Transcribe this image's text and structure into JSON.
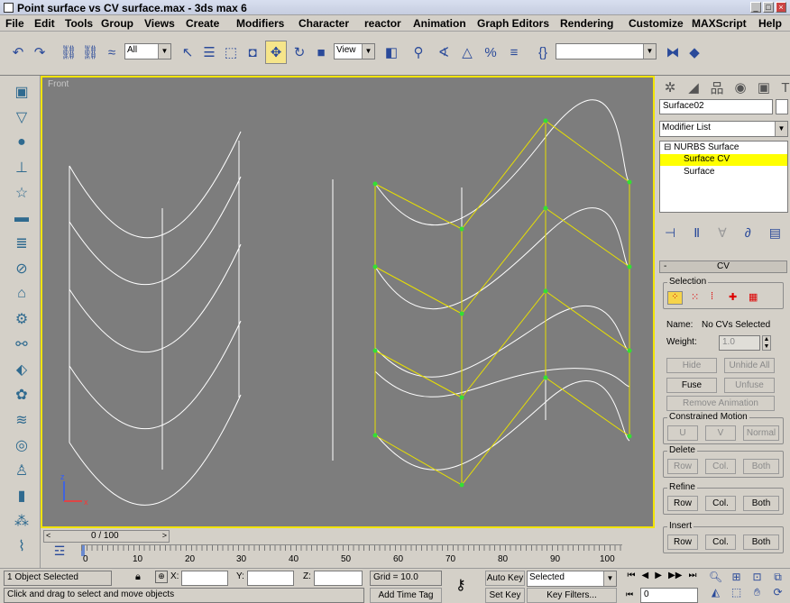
{
  "window": {
    "title": "Point surface vs CV surface.max - 3ds max 6"
  },
  "menu": [
    "File",
    "Edit",
    "Tools",
    "Group",
    "Views",
    "Create",
    "Modifiers",
    "Character",
    "reactor",
    "Animation",
    "Graph Editors",
    "Rendering",
    "Customize",
    "MAXScript",
    "Help"
  ],
  "toolbar": {
    "selection_filter": "All",
    "ref_coord": "View",
    "named_selection": ""
  },
  "viewport": {
    "label": "Front"
  },
  "command_panel": {
    "object_name": "Surface02",
    "modifier_list": "Modifier List",
    "stack": {
      "root": "NURBS Surface",
      "items": [
        "Surface CV",
        "Surface"
      ]
    },
    "rollout_title": "CV",
    "selection": {
      "label": "Selection",
      "name_label": "Name:",
      "name_value": "No CVs Selected",
      "weight_label": "Weight:",
      "weight_value": "1.0",
      "hide": "Hide",
      "unhide_all": "Unhide All",
      "fuse": "Fuse",
      "unfuse": "Unfuse",
      "remove_animation": "Remove Animation"
    },
    "constrained_motion": {
      "label": "Constrained Motion",
      "u": "U",
      "v": "V",
      "normal": "Normal"
    },
    "delete": {
      "label": "Delete",
      "row": "Row",
      "col": "Col.",
      "both": "Both"
    },
    "refine": {
      "label": "Refine",
      "row": "Row",
      "col": "Col.",
      "both": "Both"
    },
    "insert": {
      "label": "Insert",
      "row": "Row",
      "col": "Col.",
      "both": "Both"
    }
  },
  "timeline": {
    "frame": "0 / 100",
    "ticks": [
      "0",
      "10",
      "20",
      "30",
      "40",
      "50",
      "60",
      "70",
      "80",
      "90",
      "100"
    ]
  },
  "status": {
    "selected": "1 Object Selected",
    "prompt": "Click and drag to select and move objects",
    "x_label": "X:",
    "y_label": "Y:",
    "z_label": "Z:",
    "grid": "Grid = 10.0",
    "add_time_tag": "Add Time Tag",
    "auto_key": "Auto Key",
    "set_key": "Set Key",
    "key_mode": "Selected",
    "key_filters": "Key Filters...",
    "current_frame": "0"
  },
  "colors": {
    "viewport_bg": "#7d7d7d",
    "cv_lattice": "#e8e000",
    "active_highlight": "#ffff00"
  }
}
